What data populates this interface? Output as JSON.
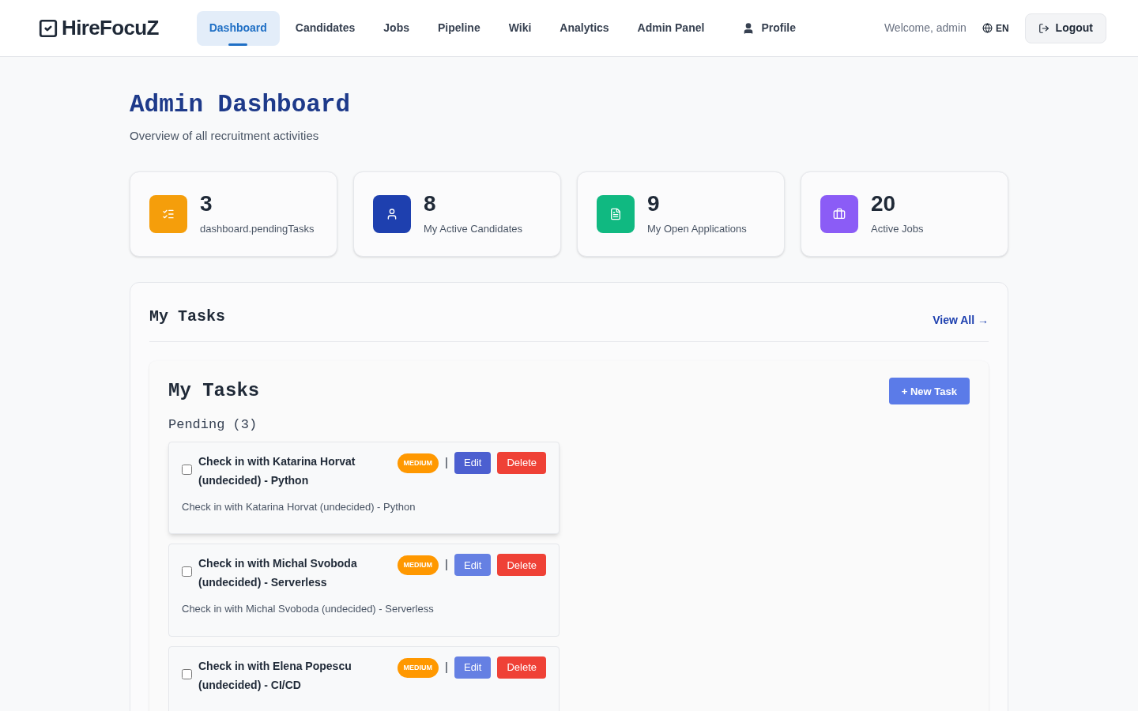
{
  "brand": {
    "name": "HireFocuZ"
  },
  "nav": [
    {
      "label": "Dashboard",
      "selected": true,
      "kind": "link"
    },
    {
      "label": "Candidates",
      "selected": false,
      "kind": "link"
    },
    {
      "label": "Jobs",
      "selected": false,
      "kind": "link"
    },
    {
      "label": "Pipeline",
      "selected": false,
      "kind": "link"
    },
    {
      "label": "Wiki",
      "selected": false,
      "kind": "link"
    },
    {
      "label": "Analytics",
      "selected": false,
      "kind": "link"
    },
    {
      "label": "Admin Panel",
      "selected": false,
      "kind": "link"
    },
    {
      "label": "Profile",
      "selected": false,
      "kind": "profile"
    }
  ],
  "welcome": "Welcome, admin",
  "language": "EN",
  "logout": "Logout",
  "page": {
    "title": "Admin Dashboard",
    "subtitle": "Overview of all recruitment activities"
  },
  "stats": [
    {
      "value": "3",
      "label": "dashboard.pendingTasks",
      "color": "#f59e0b",
      "kind": "tasks"
    },
    {
      "value": "8",
      "label": "My Active Candidates",
      "color": "#1e40af",
      "kind": "candidates"
    },
    {
      "value": "9",
      "label": "My Open Applications",
      "color": "#10b981",
      "kind": "applications"
    },
    {
      "value": "20",
      "label": "Active Jobs",
      "color": "#8b5cf6",
      "kind": "jobs"
    }
  ],
  "tasks_section": {
    "title": "My Tasks",
    "view_all": "View All →"
  },
  "tasks_panel": {
    "title": "My Tasks",
    "new_task": "+ New Task",
    "group": "Pending (3)"
  },
  "tasks": [
    {
      "title": "Check in with Katarina Horvat (undecided) - Python",
      "priority": "MEDIUM",
      "separator": "|",
      "edit": "Edit",
      "delete": "Delete",
      "description": "Check in with Katarina Horvat (undecided) - Python",
      "checked": false,
      "hovered": true
    },
    {
      "title": "Check in with Michal Svoboda (undecided) - Serverless",
      "priority": "MEDIUM",
      "separator": "|",
      "edit": "Edit",
      "delete": "Delete",
      "description": "Check in with Michal Svoboda (undecided) - Serverless",
      "checked": false,
      "hovered": false
    },
    {
      "title": "Check in with Elena Popescu (undecided) - CI/CD",
      "priority": "MEDIUM",
      "separator": "|",
      "edit": "Edit",
      "delete": "Delete",
      "checked": false,
      "hovered": false
    }
  ]
}
